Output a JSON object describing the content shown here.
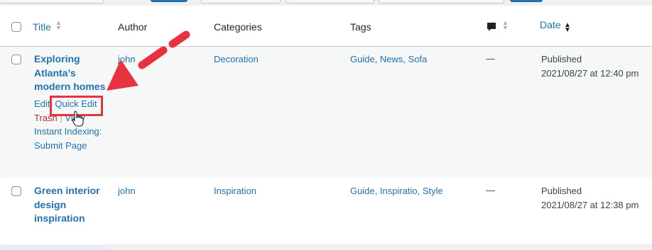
{
  "columns": {
    "title": "Title",
    "author": "Author",
    "categories": "Categories",
    "tags": "Tags",
    "date": "Date"
  },
  "icons": {
    "comment": "comment-bubble-icon",
    "sort": "sort-arrows-icon",
    "sort_desc": "sort-desc-icon",
    "cursor": "hand-pointer-icon",
    "arrow": "red-arrow-annotation"
  },
  "colors": {
    "link": "#2271b1",
    "trash": "#b32d2e",
    "annotation": "#e8323f"
  },
  "rows": [
    {
      "title_lines": [
        "Exploring",
        "Atlanta’s",
        "modern homes"
      ],
      "author": "john",
      "category": "Decoration",
      "tags": "Guide, News, Sofa",
      "comments": "—",
      "status": "Published",
      "date": "2021/08/27 at 12:40 pm",
      "actions": {
        "edit": "Edit",
        "sep": "|",
        "quick_edit": "Quick Edit",
        "trash": "Trash",
        "view": "View",
        "indexing_line1": "Instant Indexing:",
        "indexing_line2": "Submit Page"
      }
    },
    {
      "title_lines": [
        "Green interior",
        "design",
        "inspiration"
      ],
      "author": "john",
      "category": "Inspiration",
      "tags": "Guide, Inspiratio, Style",
      "comments": "—",
      "status": "Published",
      "date": "2021/08/27 at 12:38 pm"
    }
  ]
}
